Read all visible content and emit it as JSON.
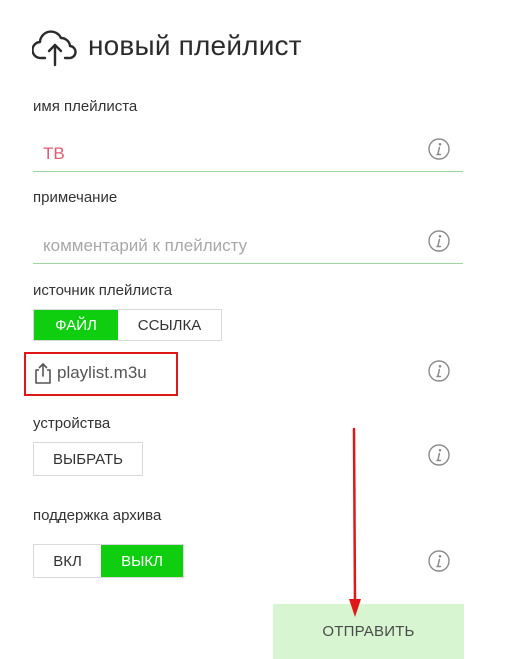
{
  "header": {
    "title": "новый плейлист",
    "icon": "cloud-upload-icon"
  },
  "fields": {
    "name": {
      "label": "имя плейлиста",
      "value": "ТВ",
      "value_color": "#e25b73"
    },
    "note": {
      "label": "примечание",
      "placeholder": "комментарий к плейлисту"
    }
  },
  "source": {
    "label": "источник плейлиста",
    "options": [
      "ФАЙЛ",
      "ССЫЛКА"
    ],
    "selected": "ФАЙЛ",
    "file_name": "playlist.m3u"
  },
  "devices": {
    "label": "устройства",
    "button": "ВЫБРАТЬ"
  },
  "archive": {
    "label": "поддержка архива",
    "options": [
      "ВКЛ",
      "ВЫКЛ"
    ],
    "selected": "ВЫКЛ"
  },
  "submit": {
    "label": "ОТПРАВИТЬ"
  },
  "colors": {
    "accent": "#0fce0f",
    "field_underline": "#9fd59f",
    "highlight": "#e01717",
    "submit_bg": "#d6f5d0"
  }
}
